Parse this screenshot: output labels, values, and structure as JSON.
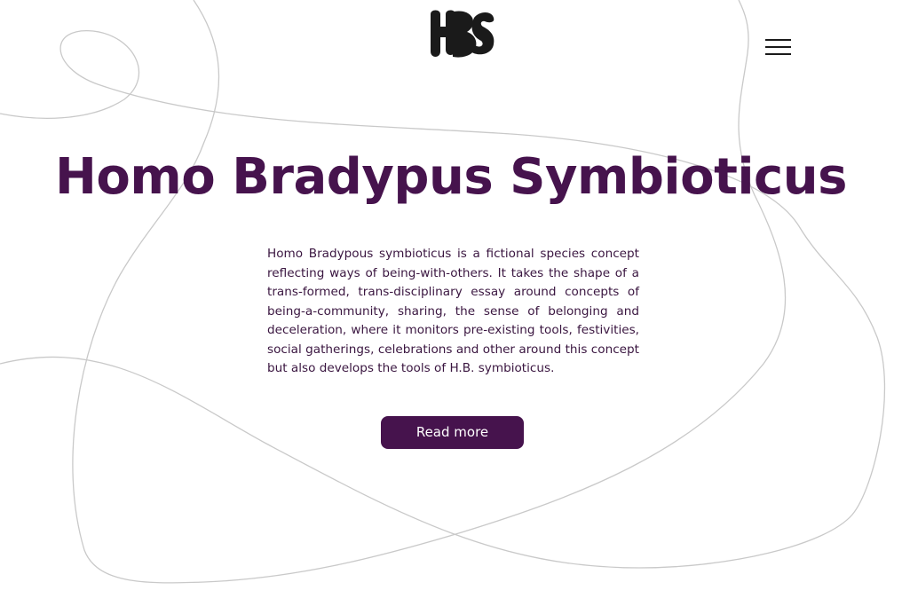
{
  "header": {
    "logo_icon": "hbs-logo-icon",
    "menu_icon": "hamburger-menu-icon"
  },
  "hero": {
    "title": "Homo Bradypus Symbioticus",
    "description": "Homo Bradypous symbioticus is a fictional species concept reflecting ways of being-with-others. It takes the shape of a trans-formed, trans-disciplinary essay around concepts of being-a-community, sharing, the sense of belonging and deceleration, where it monitors pre-existing tools, festivities, social gatherings, celebrations and other around this concept but also develops the tools of H.B. symbioticus.",
    "read_more_label": "Read more"
  },
  "colors": {
    "accent": "#46134d",
    "background": "#ffffff",
    "line": "#cccccc",
    "logo": "#1a1a1a"
  }
}
